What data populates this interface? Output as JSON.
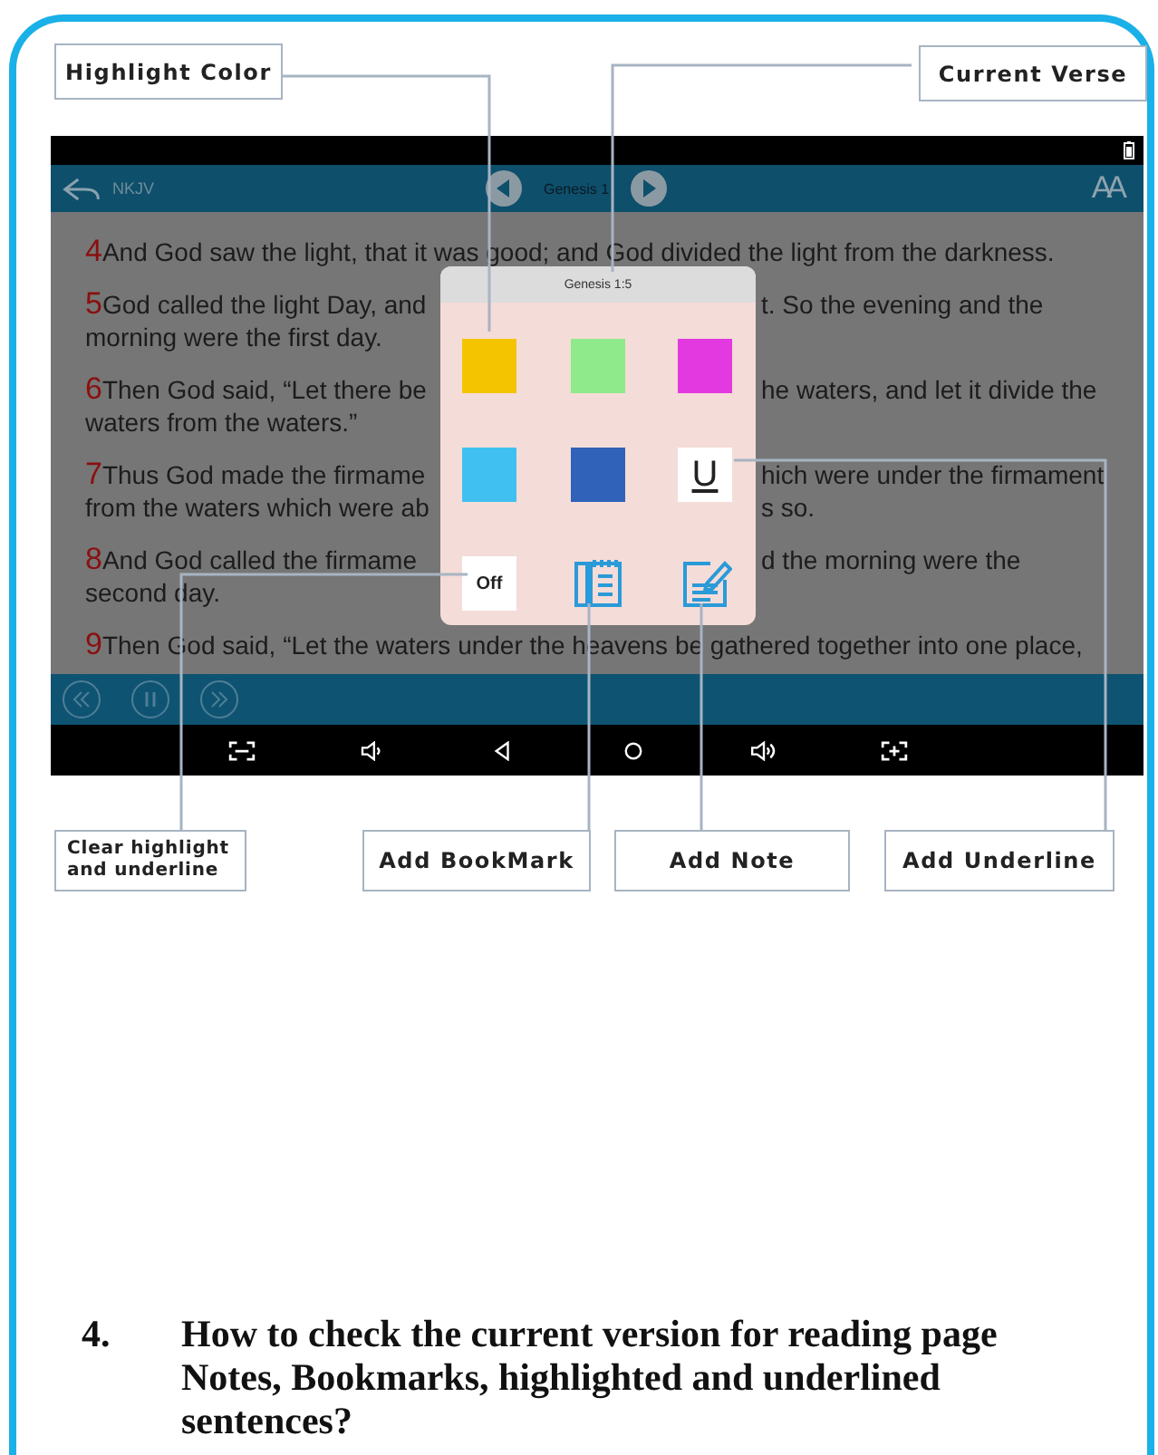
{
  "callouts_top": [
    {
      "text": "Highlight Color"
    },
    {
      "text": "Current Verse"
    }
  ],
  "app": {
    "toolbar": {
      "version": "NKJV",
      "chapter": "Genesis 1",
      "font_button": "AA"
    },
    "verses": [
      {
        "number": "4",
        "lines": [
          [
            "And God saw the light, that it was good; and God divided the light from the darkness."
          ]
        ]
      },
      {
        "number": "5",
        "lines": [
          [
            "God called the light Day, and",
            "t. So the evening and the"
          ],
          [
            "morning were the first day."
          ]
        ]
      },
      {
        "number": "6",
        "lines": [
          [
            "Then God said, “Let there be",
            "he waters, and let it divide the"
          ],
          [
            "waters from the waters.”"
          ]
        ]
      },
      {
        "number": "7",
        "lines": [
          [
            "Thus God made the firmame",
            "hich were under the firmament"
          ],
          [
            "from the waters which were ab",
            "s so."
          ]
        ]
      },
      {
        "number": "8",
        "lines": [
          [
            "And God called the firmame",
            "d the morning were the"
          ],
          [
            "second day."
          ]
        ]
      },
      {
        "number": "9",
        "lines": [
          [
            "Then God said, “Let the waters under the heavens be gathered together into one place,"
          ]
        ]
      }
    ],
    "popup": {
      "title": "Genesis 1:5",
      "items": [
        {
          "kind": "color",
          "color": "#f5c400"
        },
        {
          "kind": "color",
          "color": "#8eea8a"
        },
        {
          "kind": "color",
          "color": "#e23ae0"
        },
        {
          "kind": "color",
          "color": "#40c0f0"
        },
        {
          "kind": "color",
          "color": "#2f62b8"
        },
        {
          "kind": "underline",
          "label": "U"
        },
        {
          "kind": "off",
          "label": "Off"
        },
        {
          "kind": "bookmark"
        },
        {
          "kind": "note"
        }
      ]
    }
  },
  "callouts_bottom": [
    {
      "text": "Clear highlight and underline"
    },
    {
      "text": "Add BookMark"
    },
    {
      "text": "Add Note"
    },
    {
      "text": "Add Underline"
    }
  ],
  "question": {
    "number": "4.",
    "text": "How to check the current version for reading page Notes, Bookmarks, highlighted and underlined sentences?"
  }
}
